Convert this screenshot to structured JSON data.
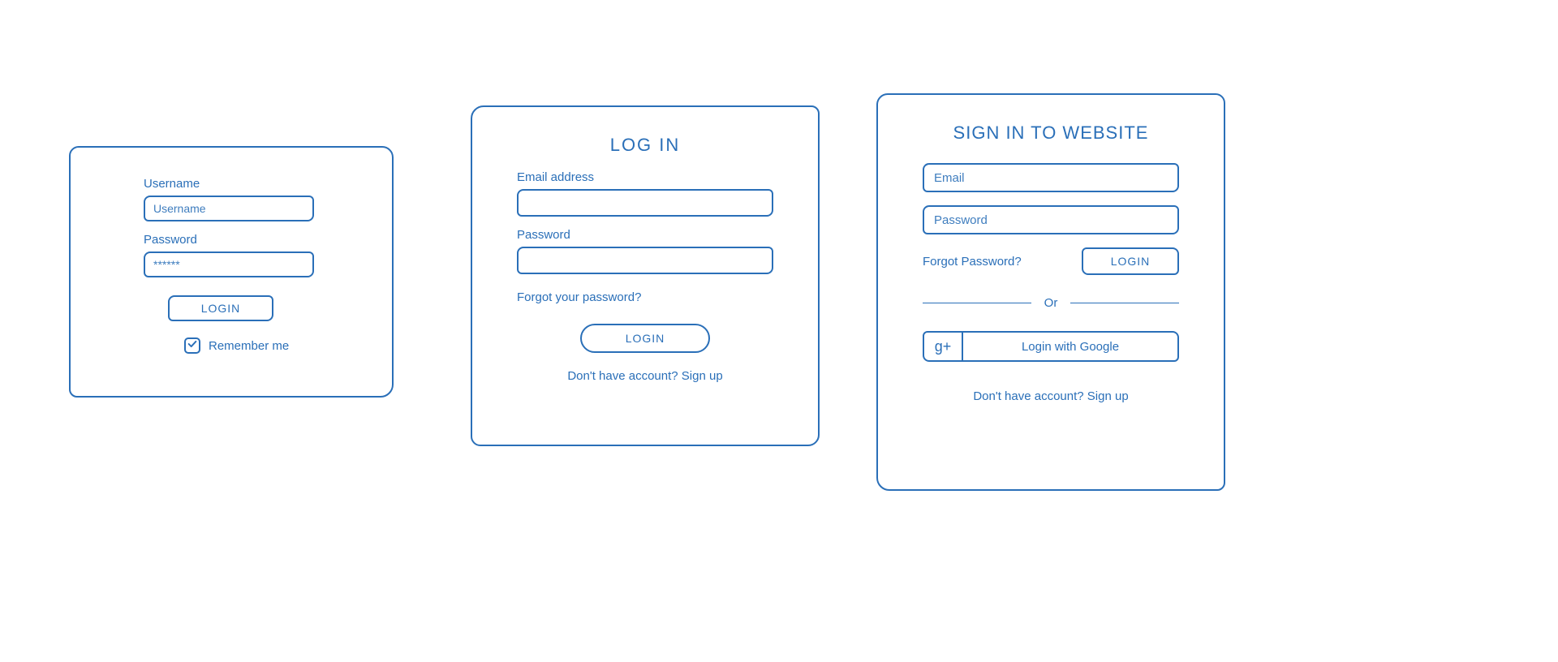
{
  "panel1": {
    "username_label": "Username",
    "username_placeholder": "Username",
    "password_label": "Password",
    "password_placeholder": "******",
    "login_button": "LOGIN",
    "remember_label": "Remember me",
    "remember_checked": true
  },
  "panel2": {
    "title": "LOG IN",
    "email_label": "Email address",
    "password_label": "Password",
    "forgot_link": "Forgot your password?",
    "login_button": "LOGIN",
    "signup_link": "Don't have account? Sign up"
  },
  "panel3": {
    "title": "SIGN IN TO WEBSITE",
    "email_placeholder": "Email",
    "password_placeholder": "Password",
    "forgot_link": "Forgot Password?",
    "login_button": "LOGIN",
    "divider": "Or",
    "google_icon": "g+",
    "google_button": "Login with Google",
    "signup_link": "Don't have account? Sign up"
  }
}
